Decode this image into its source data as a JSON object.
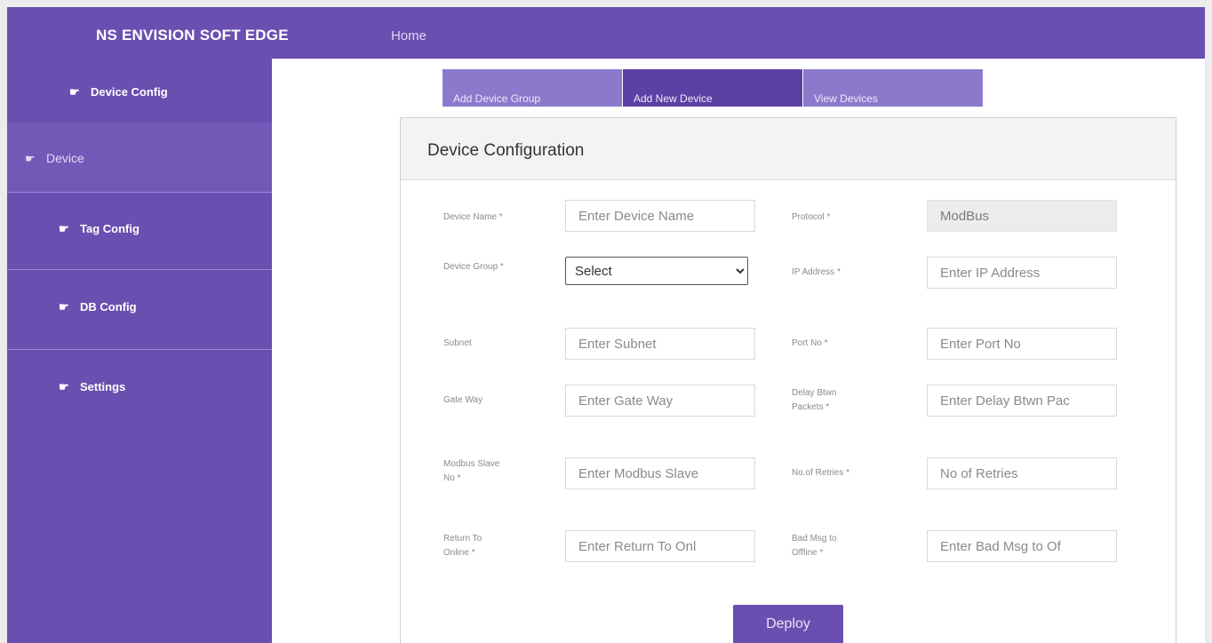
{
  "header": {
    "brand": "NS ENVISION SOFT EDGE",
    "home_link": "Home"
  },
  "sidebar": {
    "items": [
      {
        "label": "Device Config",
        "icon": "pointing-hand-icon"
      },
      {
        "label": "Device",
        "icon": "pointing-hand-icon"
      },
      {
        "label": "Tag Config",
        "icon": "pointing-hand-icon"
      },
      {
        "label": "DB Config",
        "icon": "pointing-hand-icon"
      },
      {
        "label": "Settings",
        "icon": "pointing-hand-icon"
      }
    ]
  },
  "tabs": [
    {
      "label": "Add Device Group"
    },
    {
      "label": "Add New Device",
      "active": true
    },
    {
      "label": "View Devices"
    }
  ],
  "panel": {
    "title": "Device Configuration",
    "fields": {
      "device_name": {
        "label": "Device Name *",
        "placeholder": "Enter Device Name"
      },
      "protocol": {
        "label": "Protocol *",
        "value": "ModBus"
      },
      "device_group": {
        "label": "Device Group *",
        "selected": "Select"
      },
      "ip_address": {
        "label": "IP Address *",
        "placeholder": "Enter IP Address"
      },
      "subnet": {
        "label": "Subnet",
        "placeholder": "Enter Subnet"
      },
      "port_no": {
        "label": "Port No *",
        "placeholder": "Enter Port No"
      },
      "gate_way": {
        "label": "Gate Way",
        "placeholder": "Enter Gate Way"
      },
      "delay_btwn_packets": {
        "label": "Delay Btwn Packets *",
        "placeholder": "Enter Delay Btwn Pac"
      },
      "modbus_slave_no": {
        "label": "Modbus Slave No *",
        "placeholder": "Enter Modbus Slave"
      },
      "no_of_retries": {
        "label": "No.of Retries *",
        "placeholder": "No of Retries"
      },
      "return_to_online": {
        "label": "Return To Online *",
        "placeholder": "Enter Return To Onl"
      },
      "bad_msg_to_offline": {
        "label": "Bad Msg to Offline *",
        "placeholder": "Enter Bad Msg to Of"
      }
    },
    "deploy_label": "Deploy"
  },
  "colors": {
    "accent": "#6b4fb0",
    "active_tab": "#5d40a4",
    "inactive_tab": "#8d79cc"
  }
}
